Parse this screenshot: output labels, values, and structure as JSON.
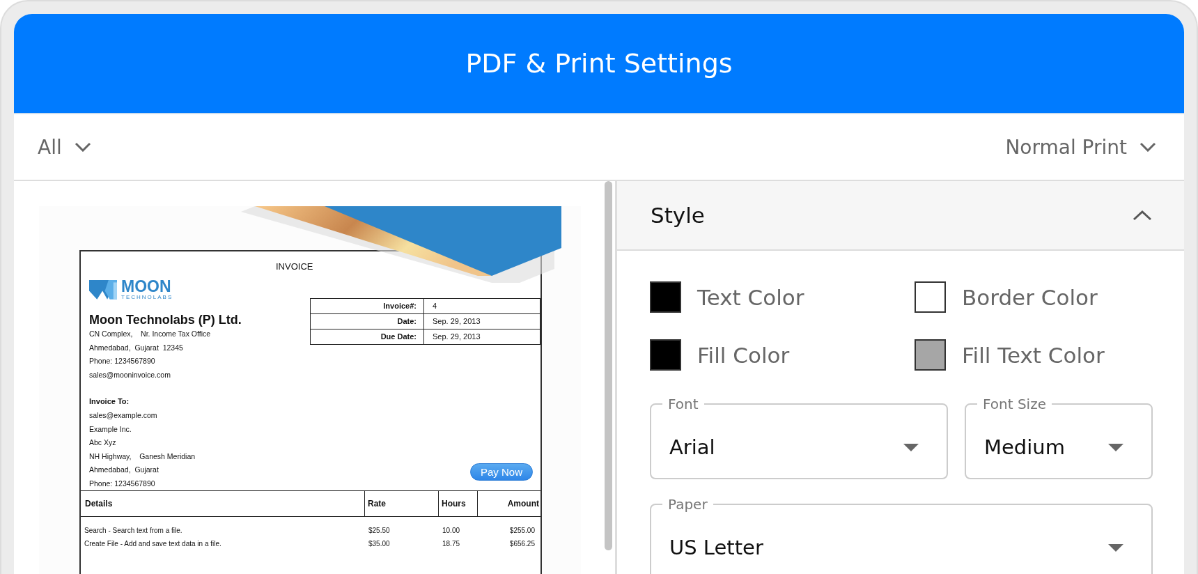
{
  "window": {
    "title": "PDF & Print Settings"
  },
  "toolbar": {
    "filter": "All",
    "print_mode": "Normal Print"
  },
  "preview": {
    "invoice": {
      "title": "INVOICE",
      "logo": {
        "name": "MOON",
        "tagline": "TECHNOLABS"
      },
      "company": "Moon Technolabs (P) Ltd.",
      "address_lines": [
        "CN Complex,    Nr. Income Tax Office",
        "Ahmedabad,  Gujarat  12345",
        "Phone: 1234567890",
        "sales@mooninvoice.com"
      ],
      "bill_to_heading": "Invoice To:",
      "bill_to_lines": [
        "sales@example.com",
        "Example Inc.",
        "Abc Xyz",
        "NH Highway,    Ganesh Meridian",
        "Ahmedabad,  Gujarat",
        "Phone: 1234567890"
      ],
      "info": [
        {
          "label": "Invoice#:",
          "value": "4"
        },
        {
          "label": "Date:",
          "value": "Sep. 29, 2013"
        },
        {
          "label": "Due Date:",
          "value": "Sep. 29, 2013"
        }
      ],
      "pay_button": "Pay Now",
      "columns": [
        "Details",
        "Rate",
        "Hours",
        "Amount"
      ],
      "rows": [
        [
          "Search - Search text from a file.",
          "$25.50",
          "10.00",
          "$255.00"
        ],
        [
          "Create File - Add and save text data in a file.",
          "$35.00",
          "18.75",
          "$656.25"
        ]
      ]
    }
  },
  "style_panel": {
    "title": "Style",
    "expanded": true,
    "colors": [
      {
        "label": "Text Color",
        "color": "#000000"
      },
      {
        "label": "Border Color",
        "color": "#ffffff"
      },
      {
        "label": "Fill Color",
        "color": "#000000"
      },
      {
        "label": "Fill Text Color",
        "color": "#a6a6a6"
      }
    ],
    "fields": [
      {
        "label": "Font",
        "value": "Arial",
        "wide": false
      },
      {
        "label": "Font Size",
        "value": "Medium",
        "wide": false
      },
      {
        "label": "Paper",
        "value": "US Letter",
        "wide": true
      }
    ]
  }
}
